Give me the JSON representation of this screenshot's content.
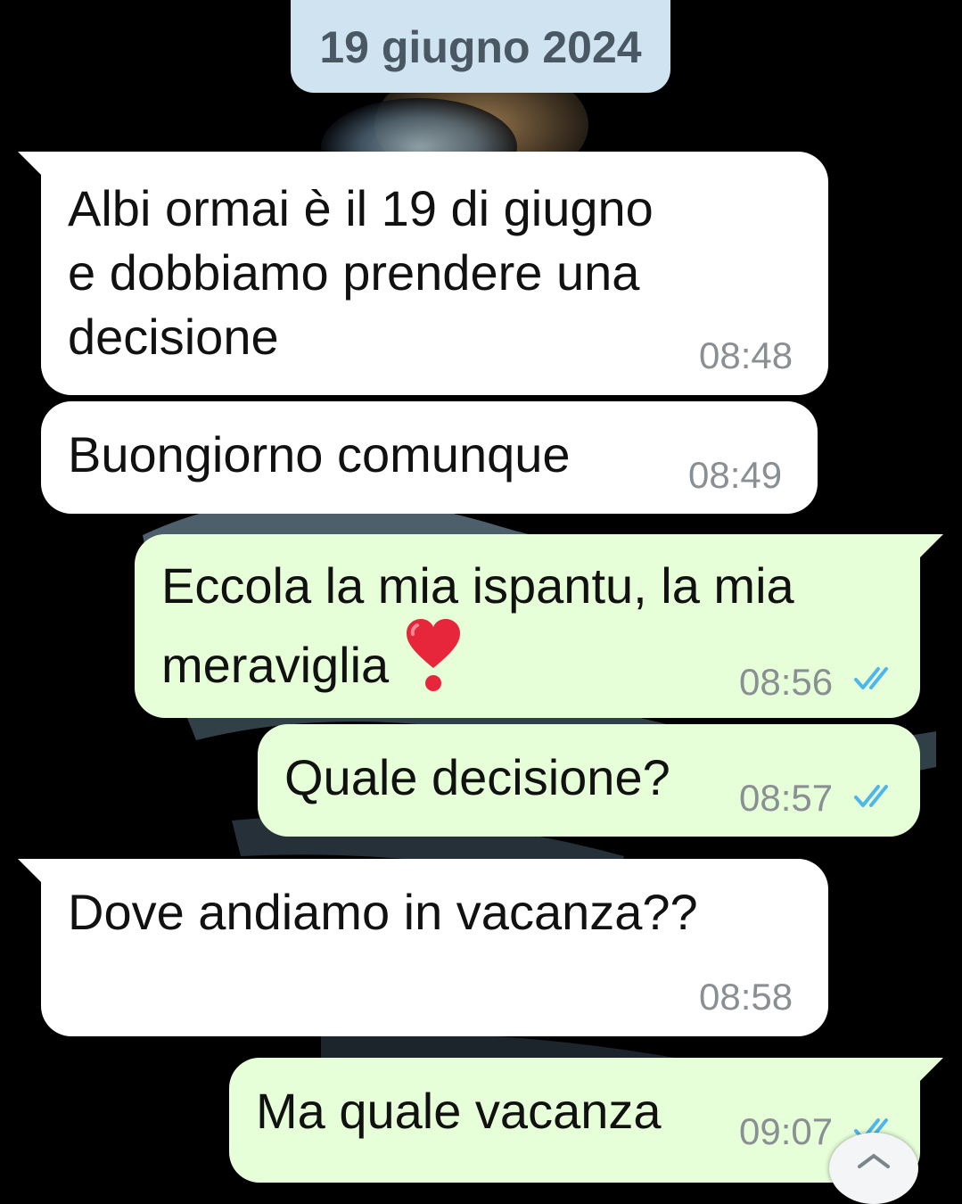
{
  "theme": {
    "incoming_bg": "#ffffff",
    "outgoing_bg": "#e6ffd9",
    "date_chip_bg": "#cfe3f1",
    "read_ticks": "#4fb6ec"
  },
  "date_separator": "19 giugno 2024",
  "messages": [
    {
      "direction": "incoming",
      "text": "Albi ormai è il 19 di giugno\ne dobbiamo prendere una\ndecisione",
      "time": "08:48"
    },
    {
      "direction": "incoming",
      "text": "Buongiorno comunque",
      "time": "08:49"
    },
    {
      "direction": "outgoing",
      "text": "Eccola la mia ispantu, la mia\nmeraviglia",
      "emoji": "heavy-heart-exclamation",
      "time": "08:56",
      "status": "read"
    },
    {
      "direction": "outgoing",
      "text": "Quale decisione?",
      "time": "08:57",
      "status": "read"
    },
    {
      "direction": "incoming",
      "text": "Dove andiamo in vacanza??",
      "time": "08:58"
    },
    {
      "direction": "outgoing",
      "text": "Ma quale vacanza",
      "time": "09:07",
      "status": "read"
    }
  ]
}
